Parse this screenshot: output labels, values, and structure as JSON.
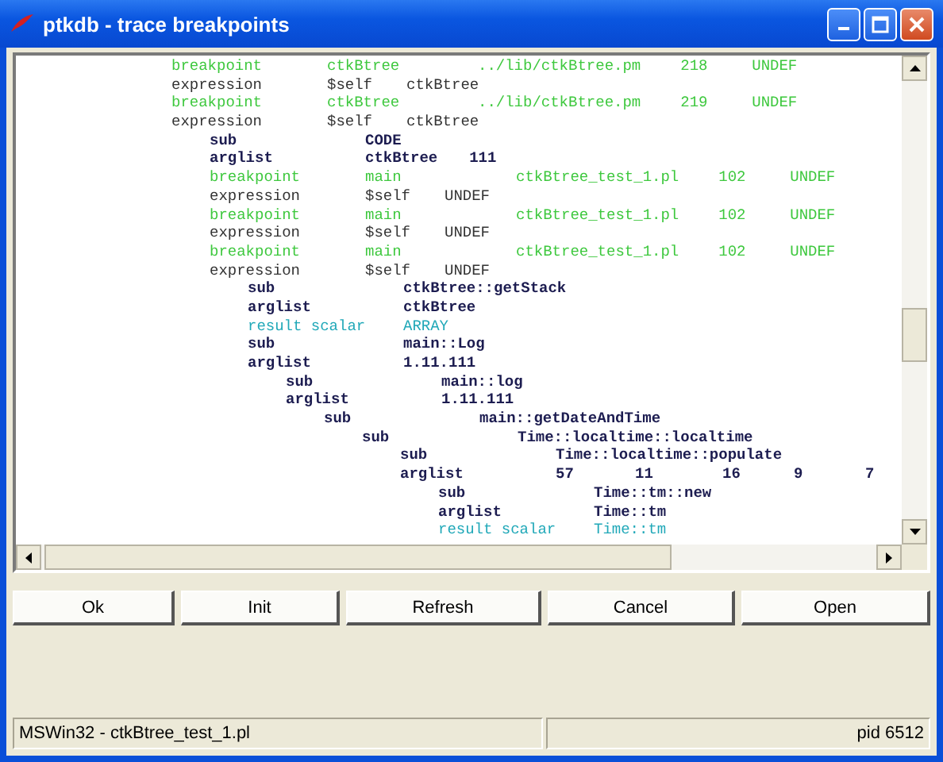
{
  "window": {
    "title": "ptkdb - trace breakpoints"
  },
  "trace": [
    {
      "kind": "breakpoint",
      "cells": [
        "breakpoint",
        "ctkBtree",
        "../lib/ctkBtree.pm",
        "218",
        "UNDEF"
      ]
    },
    {
      "kind": "expression",
      "cells": [
        "expression",
        "$self",
        "ctkBtree"
      ]
    },
    {
      "kind": "breakpoint",
      "cells": [
        "breakpoint",
        "ctkBtree",
        "../lib/ctkBtree.pm",
        "219",
        "UNDEF"
      ]
    },
    {
      "kind": "expression",
      "cells": [
        "expression",
        "$self",
        "ctkBtree"
      ],
      "children": [
        {
          "kind": "call",
          "cells": [
            "sub",
            "CODE"
          ]
        },
        {
          "kind": "call",
          "cells": [
            "arglist",
            "ctkBtree",
            "111"
          ]
        },
        {
          "kind": "breakpoint",
          "cells": [
            "breakpoint",
            "main",
            "ctkBtree_test_1.pl",
            "102",
            "UNDEF"
          ]
        },
        {
          "kind": "expression",
          "cells": [
            "expression",
            "$self",
            "UNDEF"
          ]
        },
        {
          "kind": "breakpoint",
          "cells": [
            "breakpoint",
            "main",
            "ctkBtree_test_1.pl",
            "102",
            "UNDEF"
          ]
        },
        {
          "kind": "expression",
          "cells": [
            "expression",
            "$self",
            "UNDEF"
          ]
        },
        {
          "kind": "breakpoint",
          "cells": [
            "breakpoint",
            "main",
            "ctkBtree_test_1.pl",
            "102",
            "UNDEF"
          ]
        },
        {
          "kind": "expression",
          "cells": [
            "expression",
            "$self",
            "UNDEF"
          ],
          "children": [
            {
              "kind": "call",
              "cells": [
                "sub",
                "ctkBtree::getStack"
              ]
            },
            {
              "kind": "call",
              "cells": [
                "arglist",
                "ctkBtree"
              ]
            },
            {
              "kind": "result",
              "cells": [
                "result scalar",
                "ARRAY"
              ]
            },
            {
              "kind": "call",
              "cells": [
                "sub",
                "main::Log"
              ]
            },
            {
              "kind": "call",
              "cells": [
                "arglist",
                "1.11.111"
              ],
              "children": [
                {
                  "kind": "call",
                  "cells": [
                    "sub",
                    "main::log"
                  ]
                },
                {
                  "kind": "call",
                  "cells": [
                    "arglist",
                    "1.11.111"
                  ],
                  "children": [
                    {
                      "kind": "call",
                      "cells": [
                        "sub",
                        "main::getDateAndTime"
                      ],
                      "children": [
                        {
                          "kind": "call",
                          "cells": [
                            "sub",
                            "Time::localtime::localtime"
                          ],
                          "children": [
                            {
                              "kind": "call",
                              "cells": [
                                "sub",
                                "Time::localtime::populate"
                              ]
                            },
                            {
                              "kind": "call",
                              "cells": [
                                "arglist",
                                "57",
                                "11",
                                "16",
                                "9",
                                "7"
                              ],
                              "children": [
                                {
                                  "kind": "call",
                                  "cells": [
                                    "sub",
                                    "Time::tm::new"
                                  ]
                                },
                                {
                                  "kind": "call",
                                  "cells": [
                                    "arglist",
                                    "Time::tm"
                                  ]
                                },
                                {
                                  "kind": "result",
                                  "cells": [
                                    "result scalar",
                                    "Time::tm"
                                  ]
                                }
                              ]
                            }
                          ]
                        }
                      ]
                    }
                  ]
                }
              ]
            }
          ]
        }
      ]
    }
  ],
  "buttons": [
    "Ok",
    "Init",
    "Refresh",
    "Cancel",
    "Open"
  ],
  "status_bar": {
    "left": "MSWin32 - ctkBtree_test_1.pl",
    "right": "pid 6512"
  }
}
